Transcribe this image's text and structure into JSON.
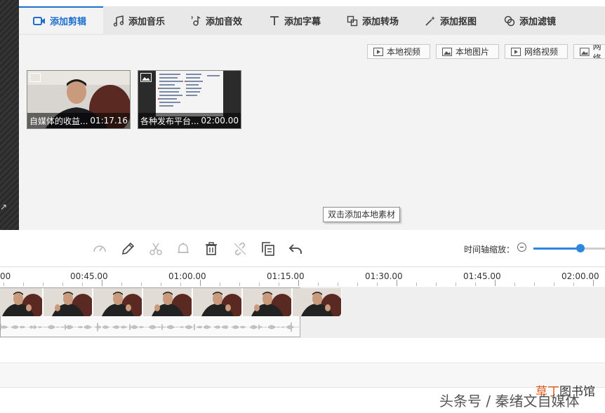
{
  "tabs": [
    {
      "label": "添加剪辑",
      "icon": "video-camera-icon",
      "active": true
    },
    {
      "label": "添加音乐",
      "icon": "music-note-icon",
      "active": false
    },
    {
      "label": "添加音效",
      "icon": "sound-effect-icon",
      "active": false
    },
    {
      "label": "添加字幕",
      "icon": "text-t-icon",
      "active": false
    },
    {
      "label": "添加转场",
      "icon": "transition-icon",
      "active": false
    },
    {
      "label": "添加抠图",
      "icon": "magic-wand-icon",
      "active": false
    },
    {
      "label": "添加滤镜",
      "icon": "filter-icon",
      "active": false
    }
  ],
  "source_buttons": [
    {
      "label": "本地视频",
      "icon": "play-box-icon"
    },
    {
      "label": "本地图片",
      "icon": "image-box-icon"
    },
    {
      "label": "网络视频",
      "icon": "play-box-icon"
    },
    {
      "label": "网络",
      "icon": "image-box-icon"
    }
  ],
  "clips": [
    {
      "title": "自媒体的收益...",
      "duration": "01:17.16",
      "type_icon": "video-icon"
    },
    {
      "title": "各种发布平台...",
      "duration": "02:00.00",
      "type_icon": "image-icon"
    }
  ],
  "tooltip": "双击添加本地素材",
  "toolbar": {
    "tools": [
      "speed-icon",
      "pencil-icon",
      "scissors-icon",
      "bell-icon",
      "trash-icon",
      "unlink-icon",
      "copy-icon",
      "undo-icon"
    ],
    "zoom_label": "时间轴缩放：",
    "zoom_level": 0.67
  },
  "ruler": {
    "labels": [
      "00",
      "00:45.00",
      "01:00.00",
      "01:15.00",
      "01:30.00",
      "01:45.00",
      "02:00.00"
    ]
  },
  "watermark": {
    "text": "头条号 / 秦绪文自媒体",
    "brand_a": "草丁",
    "brand_b": "图书馆"
  },
  "colors": {
    "accent": "#1e6fd0",
    "slider": "#2e86de",
    "brand": "#e05a1a"
  }
}
